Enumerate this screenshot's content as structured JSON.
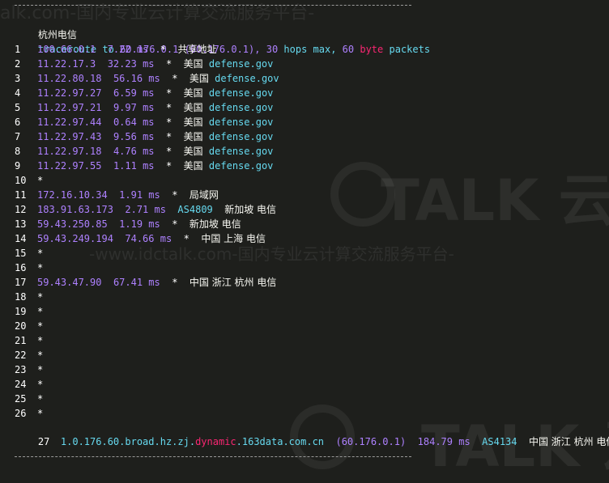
{
  "header": {
    "title": "杭州电信",
    "cmd": "traceroute",
    "to": "to",
    "target": "60.176.0.1",
    "target_paren": "(60.176.0.1),",
    "max_hops": "30",
    "hops_max": "hops max,",
    "size": "60",
    "byte": "byte",
    "packets": "packets"
  },
  "watermark": {
    "top_text": "alk.com-国内专业云计算交流服务平台-",
    "mid_text": "-www.idctalk.com-国内专业云计算交流服务平台-",
    "logo_text": "TALK 云说",
    "logo_text_bottom": "TALK 云"
  },
  "hops": [
    {
      "n": "1",
      "ip": "100.66.0.1",
      "ms": "7.22",
      "unit": "ms",
      "star": "*",
      "geo": "共享地址"
    },
    {
      "n": "2",
      "ip": "11.22.17.3",
      "ms": "32.23",
      "unit": "ms",
      "star": "*",
      "geo": "美国",
      "dom": "defense.gov"
    },
    {
      "n": "3",
      "ip": "11.22.80.18",
      "ms": "56.16",
      "unit": "ms",
      "star": "*",
      "geo": "美国",
      "dom": "defense.gov"
    },
    {
      "n": "4",
      "ip": "11.22.97.27",
      "ms": "6.59",
      "unit": "ms",
      "star": "*",
      "geo": "美国",
      "dom": "defense.gov"
    },
    {
      "n": "5",
      "ip": "11.22.97.21",
      "ms": "9.97",
      "unit": "ms",
      "star": "*",
      "geo": "美国",
      "dom": "defense.gov"
    },
    {
      "n": "6",
      "ip": "11.22.97.44",
      "ms": "0.64",
      "unit": "ms",
      "star": "*",
      "geo": "美国",
      "dom": "defense.gov"
    },
    {
      "n": "7",
      "ip": "11.22.97.43",
      "ms": "9.56",
      "unit": "ms",
      "star": "*",
      "geo": "美国",
      "dom": "defense.gov"
    },
    {
      "n": "8",
      "ip": "11.22.97.18",
      "ms": "4.76",
      "unit": "ms",
      "star": "*",
      "geo": "美国",
      "dom": "defense.gov"
    },
    {
      "n": "9",
      "ip": "11.22.97.55",
      "ms": "1.11",
      "unit": "ms",
      "star": "*",
      "geo": "美国",
      "dom": "defense.gov"
    },
    {
      "n": "10",
      "star": "*"
    },
    {
      "n": "11",
      "ip": "172.16.10.34",
      "ms": "1.91",
      "unit": "ms",
      "star": "*",
      "geo": "局域网"
    },
    {
      "n": "12",
      "ip": "183.91.63.173",
      "ms": "2.71",
      "unit": "ms",
      "asn": "AS4809",
      "geo": "新加坡 电信"
    },
    {
      "n": "13",
      "ip": "59.43.250.85",
      "ms": "1.19",
      "unit": "ms",
      "star": "*",
      "geo": "新加坡 电信"
    },
    {
      "n": "14",
      "ip": "59.43.249.194",
      "ms": "74.66",
      "unit": "ms",
      "star": "*",
      "geo": "中国 上海 电信"
    },
    {
      "n": "15",
      "star": "*"
    },
    {
      "n": "16",
      "star": "*"
    },
    {
      "n": "17",
      "ip": "59.43.47.90",
      "ms": "67.41",
      "unit": "ms",
      "star": "*",
      "geo": "中国 浙江 杭州 电信"
    },
    {
      "n": "18",
      "star": "*"
    },
    {
      "n": "19",
      "star": "*"
    },
    {
      "n": "20",
      "star": "*"
    },
    {
      "n": "21",
      "star": "*"
    },
    {
      "n": "22",
      "star": "*"
    },
    {
      "n": "23",
      "star": "*"
    },
    {
      "n": "24",
      "star": "*"
    },
    {
      "n": "25",
      "star": "*"
    },
    {
      "n": "26",
      "star": "*"
    }
  ],
  "last_hop": {
    "n": "27",
    "host_a": "1.0.176.60.broad.hz.zj.",
    "host_b": "dynamic",
    "host_c": ".163data.com.cn",
    "ip_paren": "(60.176.0.1)",
    "ms": "184.79",
    "unit": "ms",
    "asn": "AS4134",
    "geo": "中国 浙江 杭州 电信"
  }
}
